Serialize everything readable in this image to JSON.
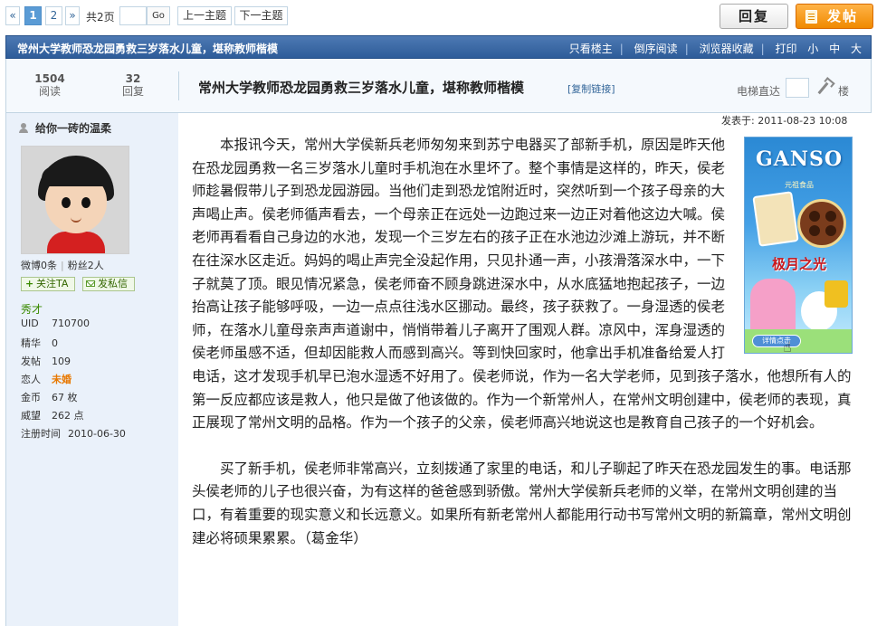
{
  "pager": {
    "prev": "«",
    "pages": [
      "1",
      "2"
    ],
    "current": "1",
    "next": "»",
    "total": "共2页",
    "go": "Go",
    "prev_topic": "上一主题",
    "next_topic": "下一主题"
  },
  "actions": {
    "reply": "回复",
    "post": "发帖"
  },
  "title_bar": {
    "title": "常州大学教师恐龙园勇救三岁落水儿童，堪称教师楷模",
    "links": [
      "只看楼主",
      "倒序阅读",
      "浏览器收藏",
      "打印"
    ],
    "font_sizes": [
      "小",
      "中",
      "大"
    ]
  },
  "stats": {
    "views": "1504",
    "views_label": "阅读",
    "replies": "32",
    "replies_label": "回复"
  },
  "thread": {
    "title": "常州大学教师恐龙园勇救三岁落水儿童，堪称教师楷模",
    "copy_link": "[复制链接]",
    "floor_jump_label": "电梯直达",
    "floor_label": "楼"
  },
  "user": {
    "name": "给你一砖的温柔",
    "weibo": "微博0条",
    "fans": "粉丝2人",
    "follow": "关注TA",
    "follow_icon": "+",
    "message": "发私信",
    "rank": "秀才",
    "info": [
      {
        "key": "UID",
        "value": "710700"
      },
      {
        "key": "精华",
        "value": "0"
      },
      {
        "key": "发帖",
        "value": "109"
      },
      {
        "key": "恋人",
        "value": "未婚"
      },
      {
        "key": "金币",
        "value": "67 枚"
      },
      {
        "key": "威望",
        "value": "262 点"
      },
      {
        "key": "注册时间",
        "value": "2010-06-30"
      }
    ]
  },
  "post": {
    "posted_at": "发表于: 2011-08-23 10:08",
    "paragraphs": [
      "　　本报讯今天，常州大学侯新兵老师匆匆来到苏宁电器买了部新手机，原因是昨天他在恐龙园勇救一名三岁落水儿童时手机泡在水里坏了。整个事情是这样的，昨天，侯老师趁暑假带儿子到恐龙园游园。当他们走到恐龙馆附近时，突然听到一个孩子母亲的大声喝止声。侯老师循声看去，一个母亲正在远处一边跑过来一边正对着他这边大喊。侯老师再看看自己身边的水池，发现一个三岁左右的孩子正在水池边沙滩上游玩，并不断在往深水区走近。妈妈的喝止声完全没起作用，只见扑通一声，小孩滑落深水中，一下子就莫了顶。眼见情况紧急，侯老师奋不顾身跳进深水中，从水底猛地抱起孩子，一边抬高让孩子能够呼吸，一边一点点往浅水区挪动。最终，孩子获救了。一身湿透的侯老师，在落水儿童母亲声声道谢中，悄悄带着儿子离开了围观人群。凉风中，浑身湿透的侯老师虽感不适，但却因能救人而感到高兴。等到快回家时，他拿出手机准备给爱人打电话，这才发现手机早已泡水湿透不好用了。侯老师说，作为一名大学老师，见到孩子落水，他想所有人的第一反应都应该是救人，他只是做了他该做的。作为一个新常州人，在常州文明创建中，侯老师的表现，真正展现了常州文明的品格。作为一个孩子的父亲，侯老师高兴地说这也是教育自己孩子的一个好机会。",
      "　　买了新手机，侯老师非常高兴，立刻拨通了家里的电话，和儿子聊起了昨天在恐龙园发生的事。电话那头侯老师的儿子也很兴奋，为有这样的爸爸感到骄傲。常州大学侯新兵老师的义举，在常州文明创建的当口，有着重要的现实意义和长远意义。如果所有新老常州人都能用行动书写常州文明的新篇章，常州文明创建必将硕果累累。（葛金华）"
    ]
  },
  "ad": {
    "brand": "GANSO",
    "brand_sub": "元祖食品",
    "tagline": "极月之光",
    "cta": "详情点击"
  },
  "colors": {
    "title_bar": "#3a67a6",
    "sidebar": "#eaf1fa",
    "post_button": "#f08a00",
    "link": "#336699",
    "rank": "#3a8a00"
  }
}
